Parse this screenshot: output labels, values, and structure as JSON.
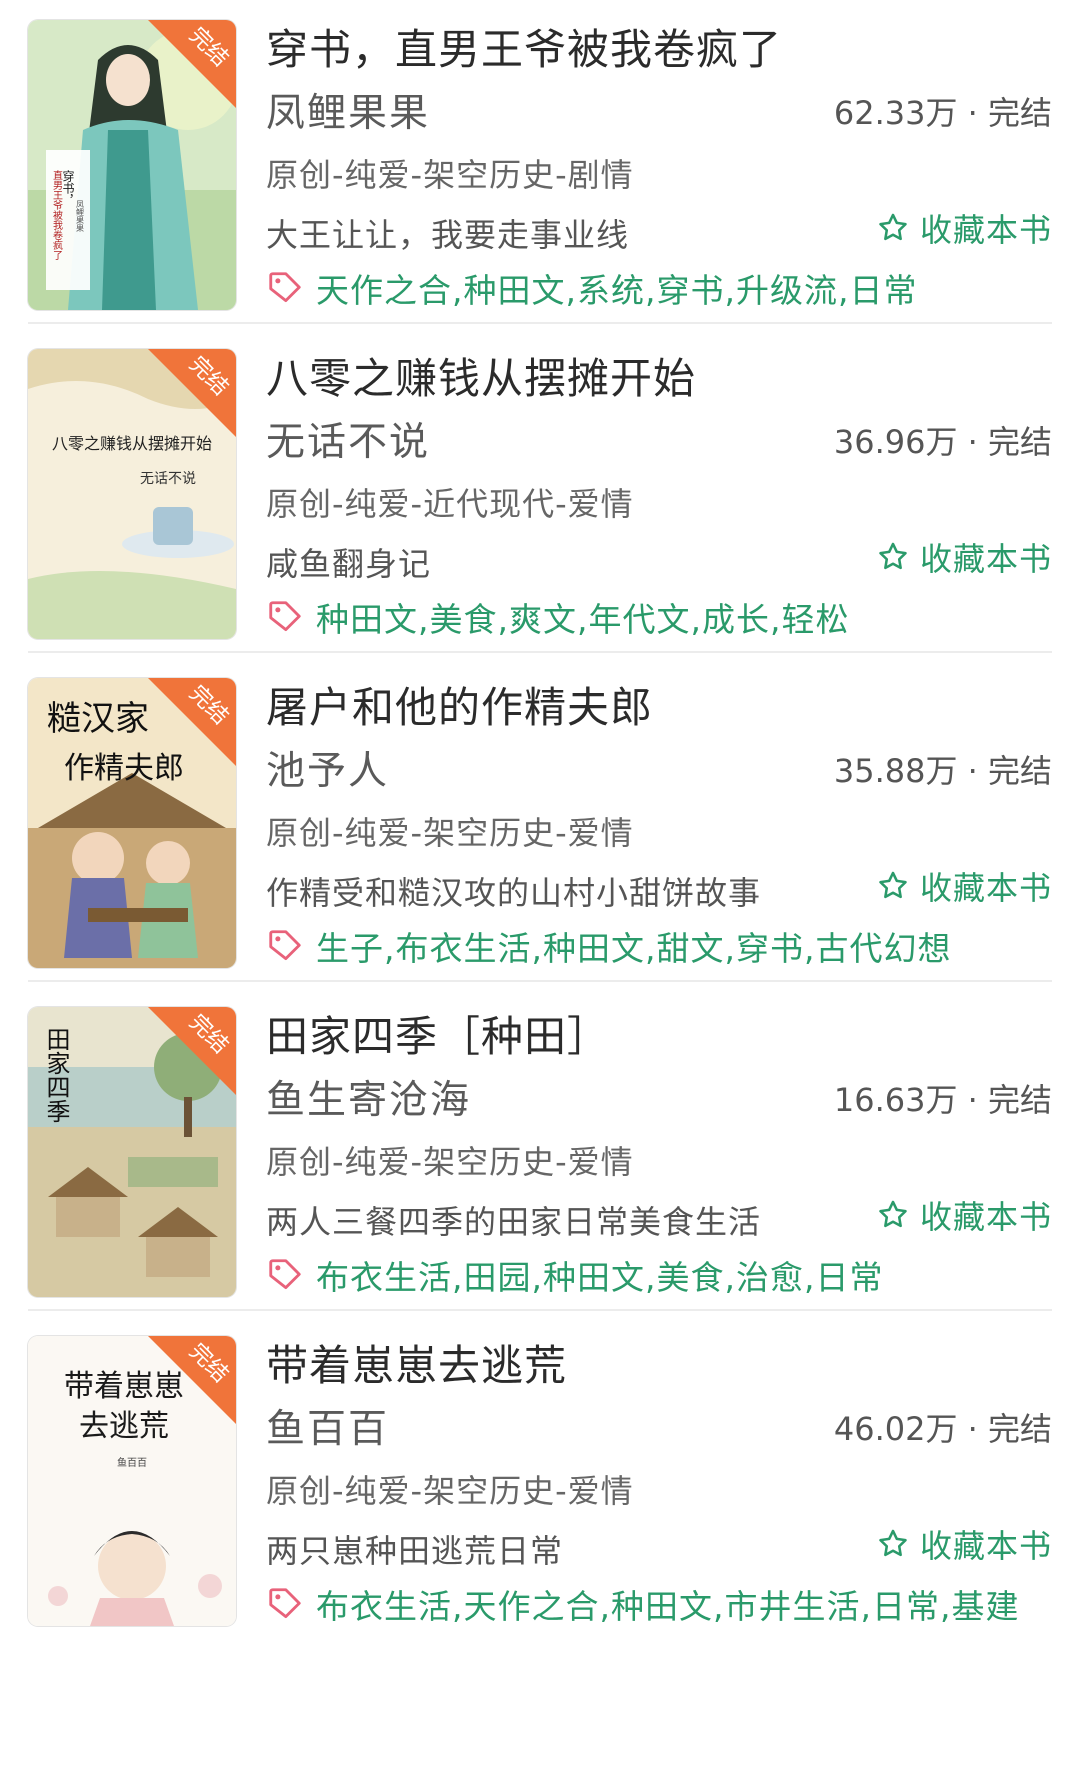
{
  "colors": {
    "accent_green": "#2a9a6a",
    "tag_icon": "#e8627a",
    "badge_orange": "#f0743a"
  },
  "favorite_icon": "star-outline-icon",
  "tag_icon": "tag-icon",
  "books": [
    {
      "title": "穿书，直男王爷被我卷疯了",
      "author": "凤鲤果果",
      "stats": "62.33万 · 完结",
      "category": "原创-纯爱-架空历史-剧情",
      "description": "大王让让，我要走事业线",
      "favorite_label": "收藏本书",
      "tags": "天作之合,种田文,系统,穿书,升级流,日常",
      "badge": "完结",
      "cover_text": [
        "穿书，",
        "直男王爷被我卷疯了",
        "凤鲤果果"
      ]
    },
    {
      "title": "八零之赚钱从摆摊开始",
      "author": "无话不说",
      "stats": "36.96万 · 完结",
      "category": "原创-纯爱-近代现代-爱情",
      "description": "咸鱼翻身记",
      "favorite_label": "收藏本书",
      "tags": "种田文,美食,爽文,年代文,成长,轻松",
      "badge": "完结",
      "cover_text": [
        "八零之赚钱从摆摊开始",
        "无话不说"
      ]
    },
    {
      "title": "屠户和他的作精夫郎",
      "author": "池予人",
      "stats": "35.88万 · 完结",
      "category": "原创-纯爱-架空历史-爱情",
      "description": "作精受和糙汉攻的山村小甜饼故事",
      "favorite_label": "收藏本书",
      "tags": "生子,布衣生活,种田文,甜文,穿书,古代幻想",
      "badge": "完结",
      "cover_text": [
        "糙汉家",
        "作精夫郎"
      ]
    },
    {
      "title": "田家四季［种田］",
      "author": "鱼生寄沧海",
      "stats": "16.63万 · 完结",
      "category": "原创-纯爱-架空历史-爱情",
      "description": "两人三餐四季的田家日常美食生活",
      "favorite_label": "收藏本书",
      "tags": "布衣生活,田园,种田文,美食,治愈,日常",
      "badge": "完结",
      "cover_text": [
        "田家四季"
      ]
    },
    {
      "title": "带着崽崽去逃荒",
      "author": "鱼百百",
      "stats": "46.02万 · 完结",
      "category": "原创-纯爱-架空历史-爱情",
      "description": "两只崽种田逃荒日常",
      "favorite_label": "收藏本书",
      "tags": "布衣生活,天作之合,种田文,市井生活,日常,基建",
      "badge": "完结",
      "cover_text": [
        "带着崽崽",
        "去逃荒",
        "鱼百百"
      ]
    }
  ]
}
